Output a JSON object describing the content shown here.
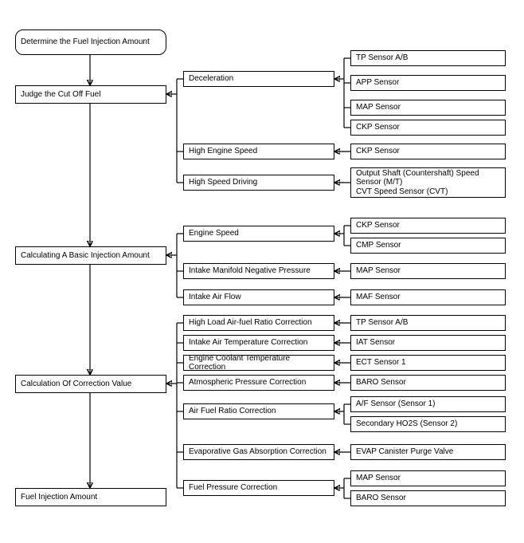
{
  "main": {
    "determine": "Determine the Fuel Injection Amount",
    "judge": "Judge the Cut Off Fuel",
    "basic": "Calculating A Basic Injection Amount",
    "correction": "Calculation Of Correction Value",
    "result": "Fuel Injection Amount"
  },
  "mid": {
    "decel": "Deceleration",
    "highEngine": "High Engine Speed",
    "highDriving": "High Speed Driving",
    "engineSpeed": "Engine Speed",
    "intakeNeg": "Intake Manifold Negative Pressure",
    "intakeAir": "Intake Air Flow",
    "highLoad": "High Load Air-fuel Ratio Correction",
    "intakeTemp": "Intake Air Temperature Correction",
    "coolant": "Engine Coolant Temperature Correction",
    "atmos": "Atmospheric Pressure Correction",
    "afRatio": "Air Fuel Ratio Correction",
    "evap": "Evaporative Gas Absorption Correction",
    "fuelPress": "Fuel Pressure Correction"
  },
  "sensor": {
    "tpAB": "TP Sensor A/B",
    "app": "APP Sensor",
    "map": "MAP Sensor",
    "ckp": "CKP Sensor",
    "ckp2": "CKP Sensor",
    "output": "Output Shaft (Countershaft) Speed Sensor (M/T)\nCVT Speed Sensor (CVT)",
    "ckp3": "CKP Sensor",
    "cmp": "CMP Sensor",
    "map2": "MAP Sensor",
    "maf": "MAF Sensor",
    "tpAB2": "TP Sensor A/B",
    "iat": "IAT Sensor",
    "ect": "ECT Sensor 1",
    "baro": "BARO Sensor",
    "af": "A/F Sensor (Sensor 1)",
    "ho2s": "Secondary HO2S (Sensor 2)",
    "evapV": "EVAP Canister Purge Valve",
    "map3": "MAP Sensor",
    "baro2": "BARO Sensor"
  }
}
